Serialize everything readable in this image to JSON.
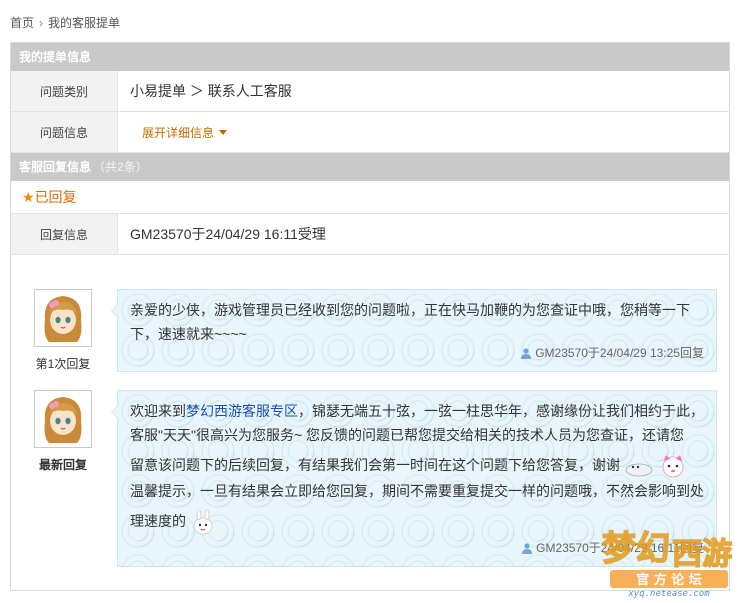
{
  "breadcrumb": {
    "home": "首页",
    "current": "我的客服提单"
  },
  "ticket_info": {
    "heading": "我的提单信息",
    "category_label": "问题类别",
    "category_value": "小易提单 ＞ 联系人工客服",
    "issue_label": "问题信息",
    "expand_label": "展开详细信息"
  },
  "reply_info": {
    "heading": "客服回复信息",
    "count": "（共2条）",
    "status": "已回复",
    "info_label": "回复信息",
    "info_value": "GM23570于24/04/29 16:11受理"
  },
  "messages": [
    {
      "label": "第1次回复",
      "text": "亲爱的少侠，游戏管理员已经收到您的问题啦，正在快马加鞭的为您查证中哦，您稍等一下下，速速就来~~~~",
      "signature": "GM23570于24/04/29 13:25回复"
    },
    {
      "label": "最新回复",
      "text_pre": "欢迎来到",
      "link": "梦幻西游客服专区",
      "text_line1_rest": "，锦瑟无端五十弦，一弦一柱思华年，感谢缘份让我们相约于此，",
      "text_line2": "客服\"天天\"很高兴为您服务~ 您反馈的问题已帮您提交给相关的技术人员为您查证，还请您",
      "text_line3": "留意该问题下的后续回复，有结果我们会第一时间在这个问题下给您答复，谢谢",
      "text_line4": "温馨提示，一旦有结果会立即给您回复，期间不需要重复提交一样的问题哦，不然会影响到处",
      "text_line5": "理速度的",
      "signature": "GM23570于24/04/29 16:11回复"
    }
  ],
  "watermark": {
    "site": "xyq.netease.com"
  },
  "colors": {
    "header_bg": "#c9c9c9",
    "accent_orange": "#e3690a",
    "link_blue": "#1a4fb3",
    "bubble_bg": "#e8f5fb"
  }
}
